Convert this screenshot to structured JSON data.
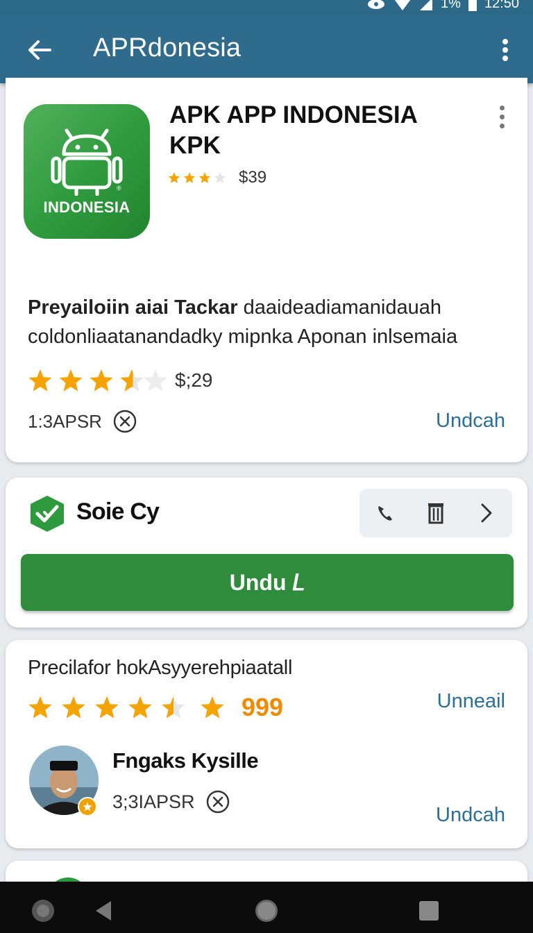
{
  "status": {
    "time": "12:50",
    "battery": "1%"
  },
  "appbar": {
    "title": "APRdonesia"
  },
  "app_card": {
    "icon_label": "INDONESIA",
    "name_line1": "APK APP INDONESIA",
    "name_line2": "KPK",
    "small_rating_stars": 3,
    "small_rating_price": "$39",
    "desc_bold": "Preyailoiin aiai Tackar",
    "desc_rest": " daaideadiamanidauah coldonliaatanandadky mipnka Aponan inlsemaia",
    "big_rating_stars": 3.5,
    "big_rating_price": "$;29",
    "meta_text": "1:3APSR",
    "action_link": "Undcah"
  },
  "install_card": {
    "brand_name": "Soie Cy",
    "toolbar_icons": [
      "phone-icon",
      "trash-icon",
      "chevron-right-icon"
    ],
    "cta_label": "Undu 𝘓"
  },
  "review_card": {
    "title": "Precilafor hokAsyyerehpiaatall",
    "rating_stars": 4.5,
    "rating_count": "999",
    "top_link": "Unneail",
    "reviewer_name": "Fngaks Kysille",
    "reviewer_meta": "3;3IAPSR",
    "bottom_link": "Undcah"
  },
  "colors": {
    "appbar": "#2e6b8d",
    "green": "#2f8c3c",
    "link": "#2a6f97",
    "star": "#f5a300",
    "count": "#f08a00"
  }
}
